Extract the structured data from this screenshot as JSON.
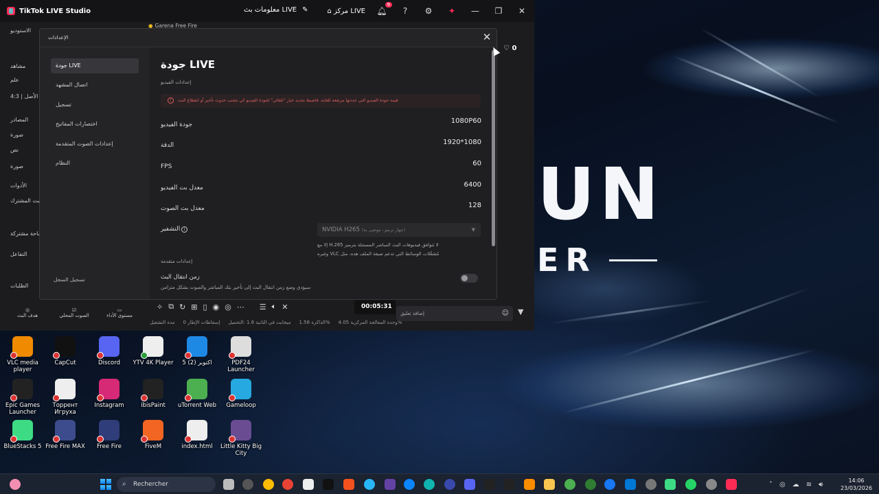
{
  "app": {
    "title": "TikTok LIVE Studio",
    "stream_info": "معلومات بث LIVE",
    "live_center": "مركز LIVE",
    "notif_count": "9",
    "left_panel": [
      "الاستوديو",
      "مشاهد",
      "علم",
      "4:3 | الأصل",
      "المصادر",
      "صورة",
      "نص",
      "صورة",
      "الأدوات",
      "البث المشترك",
      "مساحة مشتركة",
      "التفاعل",
      "الطلبات",
      "الصوت المحلي",
      "هدف البث",
      "مستوى الأداء"
    ],
    "scene_tabs": [
      "Garena Free Fire"
    ],
    "likes": "0",
    "timer": "00:05:31",
    "stats": [
      "مدة التشغيل",
      "إسقاطات الإطار 0",
      "ميجابت في الثانية 1.6 :التحميل",
      "الذاكرة 1.58%",
      "وحدة المعالجة المركزية 4.05%"
    ],
    "comment_placeholder": "إضافة تعليق"
  },
  "dialog": {
    "title": "الإعدادات",
    "close_icon": "close-icon",
    "sidebar": [
      {
        "label": "جودة LIVE",
        "active": true
      },
      {
        "label": "اتصال المشهد"
      },
      {
        "label": "تسجيل"
      },
      {
        "label": "اختصارات المفاتيح"
      },
      {
        "label": "إعدادات الصوت المتقدمة"
      },
      {
        "label": "النظام"
      }
    ],
    "sidebar_footer": "تسجيل السجل",
    "main": {
      "heading": "جودة LIVE",
      "video_section": "إعدادات الفيديو",
      "warning": "قيمة جودة الفيديو التي حددتها مرتفعة للغاية. فاضبط تحديد خيار \"تلقائي\" لجودة الفيديو كي تتجنب حدوث تأخير أو انقطاع البث",
      "rows": [
        {
          "label": "جودة الفيديو",
          "value": "1080P60"
        },
        {
          "label": "الدقة",
          "value": "1920*1080"
        },
        {
          "label": "FPS",
          "value": "60"
        },
        {
          "label": "معدل بت الفيديو",
          "value": "6400"
        },
        {
          "label": "معدل بت الصوت",
          "value": "128"
        }
      ],
      "encoder_label": "التشفير",
      "encoder_value": "NVIDIA H265",
      "encoder_sub": "(جهاز ترميز- موصى به)",
      "encoder_note_1": "إلا مع H.265 لا تتوافق فيديوهات البث المباشر المسجلة بترميز",
      "encoder_note_2": "وغيره VLC مُشغّلات الوسائط التي تدعم صيغة الملف هذه، مثل",
      "advanced_section": "إعدادات متقدمة",
      "latency_label": "زمن انتقال البث",
      "latency_desc": "سيؤدي وضع زمن انتقال البث إلى تأخير بثك المباشر والصوت بشكل متزامن"
    }
  },
  "wallpaper": {
    "brand_top": "UN",
    "brand_bottom": "ER"
  },
  "desktop": [
    {
      "label": "VLC media player",
      "color": "#f08a00"
    },
    {
      "label": "CapCut",
      "color": "#111111"
    },
    {
      "label": "Discord",
      "color": "#5865f2"
    },
    {
      "label": "YTV 4K Player",
      "color": "#eeeeee"
    },
    {
      "label": "5 اكتوبر (2)",
      "color": "#1e88e5"
    },
    {
      "label": "PDF24 Launcher",
      "color": "#dddddd"
    },
    {
      "label": "Epic Games Launcher",
      "color": "#222222"
    },
    {
      "label": "Торрент Игруха",
      "color": "#eeeeee"
    },
    {
      "label": "Instagram",
      "color": "#d62976"
    },
    {
      "label": "ibisPaint",
      "color": "#222222"
    },
    {
      "label": "uTorrent Web",
      "color": "#4caf50"
    },
    {
      "label": "Gameloop",
      "color": "#26a9e0"
    },
    {
      "label": "BlueStacks 5",
      "color": "#3ddc84"
    },
    {
      "label": "Free Fire MAX",
      "color": "#3c4c8c"
    },
    {
      "label": "Free Fire",
      "color": "#2f3d7a"
    },
    {
      "label": "FiveM",
      "color": "#f26522"
    },
    {
      "label": "index.html",
      "color": "#eeeeee"
    },
    {
      "label": "Little Kitty Big City",
      "color": "#6a4c93"
    }
  ],
  "taskbar": {
    "search": "Rechercher",
    "time": "14:06",
    "date": "23/03/2026"
  }
}
